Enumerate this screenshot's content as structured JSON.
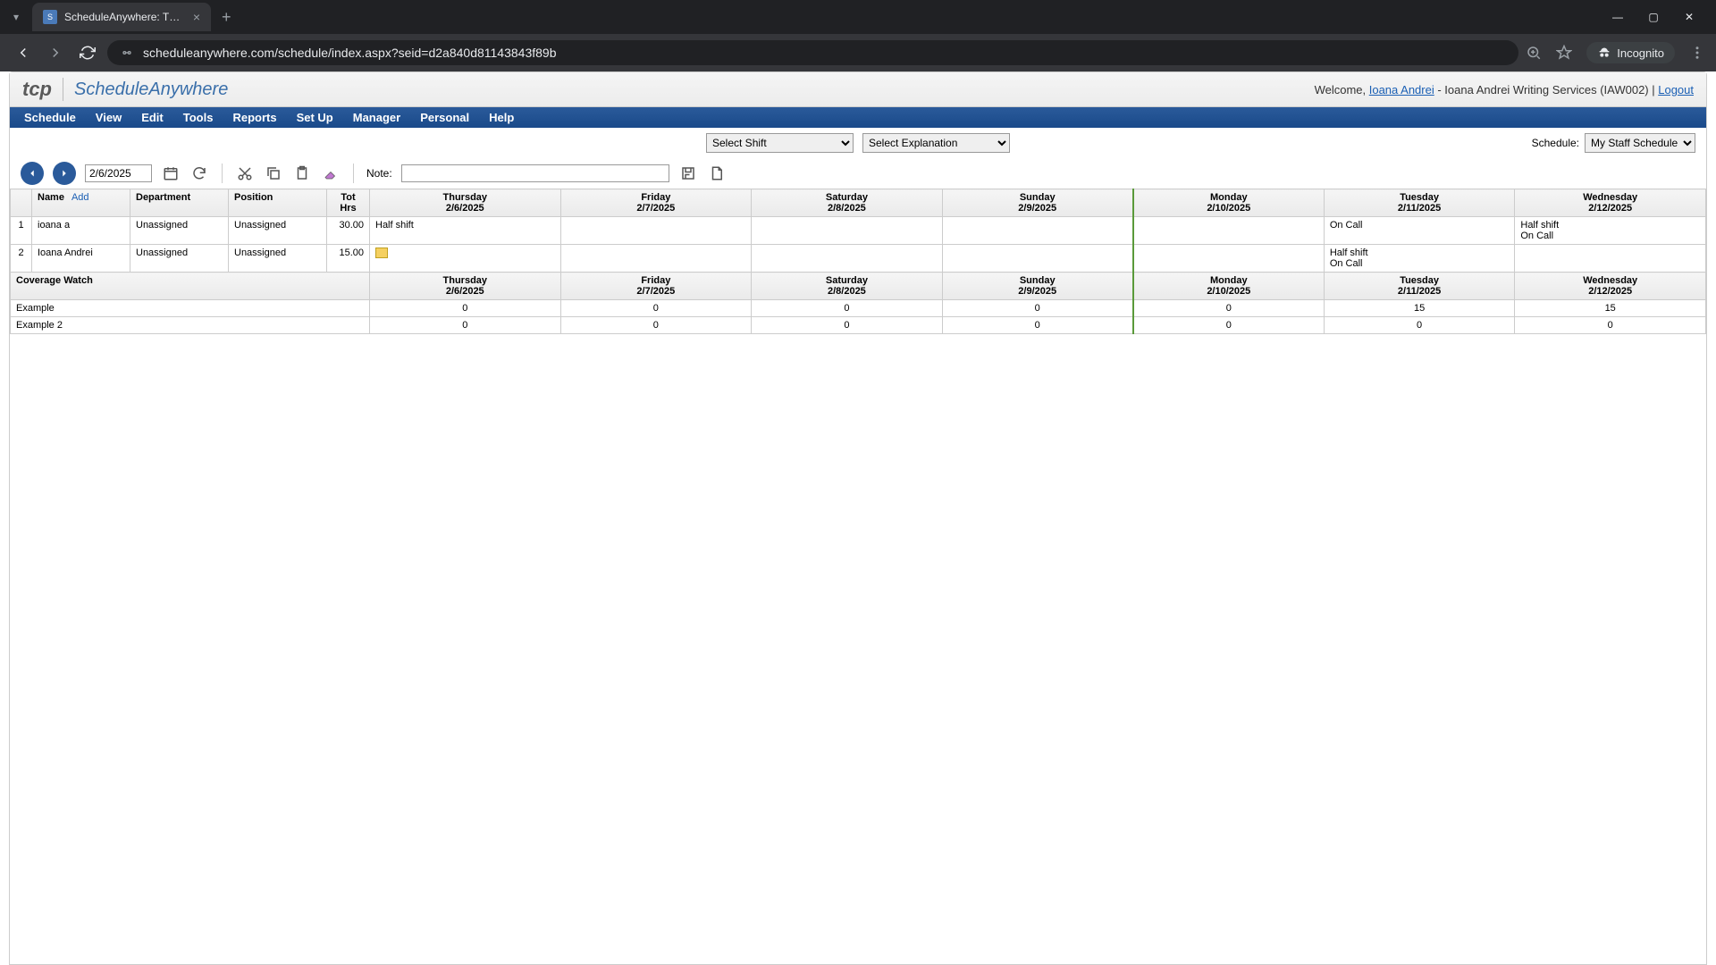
{
  "browser": {
    "tab_title": "ScheduleAnywhere: The easy, a",
    "url": "scheduleanywhere.com/schedule/index.aspx?seid=d2a840d81143843f89b",
    "incognito_label": "Incognito"
  },
  "header": {
    "logo_left": "tcp",
    "logo_right": "ScheduleAnywhere",
    "welcome_prefix": "Welcome, ",
    "user_link": "Ioana Andrei",
    "user_suffix": " - Ioana Andrei Writing Services (IAW002) | ",
    "logout": "Logout"
  },
  "menu": [
    "Schedule",
    "View",
    "Edit",
    "Tools",
    "Reports",
    "Set Up",
    "Manager",
    "Personal",
    "Help"
  ],
  "toolbar": {
    "shift_placeholder": "Select Shift",
    "explanation_placeholder": "Select Explanation",
    "schedule_label": "Schedule:",
    "schedule_value": "My Staff Schedule",
    "date_value": "2/6/2025",
    "note_label": "Note:"
  },
  "table": {
    "headers": {
      "name": "Name",
      "add": "Add",
      "department": "Department",
      "position": "Position",
      "tot_hrs": "Tot Hrs"
    },
    "days": [
      {
        "dow": "Thursday",
        "date": "2/6/2025"
      },
      {
        "dow": "Friday",
        "date": "2/7/2025"
      },
      {
        "dow": "Saturday",
        "date": "2/8/2025"
      },
      {
        "dow": "Sunday",
        "date": "2/9/2025"
      },
      {
        "dow": "Monday",
        "date": "2/10/2025"
      },
      {
        "dow": "Tuesday",
        "date": "2/11/2025"
      },
      {
        "dow": "Wednesday",
        "date": "2/12/2025"
      }
    ],
    "rows": [
      {
        "idx": "1",
        "name": "ioana a",
        "department": "Unassigned",
        "position": "Unassigned",
        "hrs": "30.00",
        "cells": [
          "Half shift",
          "",
          "",
          "",
          "",
          "On Call",
          "Half shift\nOn Call"
        ]
      },
      {
        "idx": "2",
        "name": "Ioana Andrei",
        "department": "Unassigned",
        "position": "Unassigned",
        "hrs": "15.00",
        "cells": [
          "__NOTE_ICON__",
          "",
          "",
          "",
          "",
          "Half shift\nOn Call",
          ""
        ]
      }
    ],
    "coverage_label": "Coverage Watch",
    "coverage_rows": [
      {
        "name": "Example",
        "vals": [
          "0",
          "0",
          "0",
          "0",
          "0",
          "15",
          "15"
        ]
      },
      {
        "name": "Example 2",
        "vals": [
          "0",
          "0",
          "0",
          "0",
          "0",
          "0",
          "0"
        ]
      }
    ]
  }
}
